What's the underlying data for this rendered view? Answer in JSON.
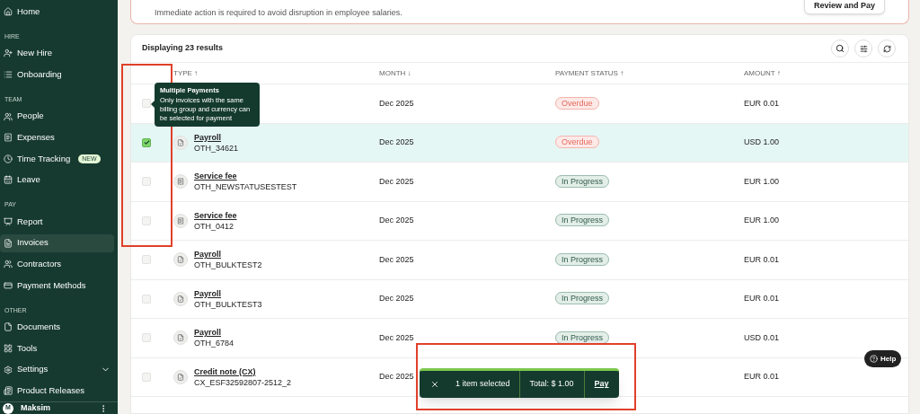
{
  "sidebar": {
    "sections": [
      {
        "items": [
          {
            "label": "Home",
            "selected": false
          }
        ]
      },
      {
        "heading": "HIRE",
        "items": [
          {
            "label": "New Hire",
            "selected": false
          },
          {
            "label": "Onboarding",
            "selected": false
          }
        ]
      },
      {
        "heading": "TEAM",
        "items": [
          {
            "label": "People",
            "selected": false
          },
          {
            "label": "Expenses",
            "selected": false
          },
          {
            "label": "Time Tracking",
            "badge": "NEW",
            "selected": false
          },
          {
            "label": "Leave",
            "selected": false
          }
        ]
      },
      {
        "heading": "PAY",
        "items": [
          {
            "label": "Report",
            "selected": false
          },
          {
            "label": "Invoices",
            "selected": true
          },
          {
            "label": "Contractors",
            "selected": false
          },
          {
            "label": "Payment Methods",
            "selected": false
          }
        ]
      },
      {
        "heading": "OTHER",
        "items": [
          {
            "label": "Documents",
            "selected": false
          },
          {
            "label": "Tools",
            "selected": false
          },
          {
            "label": "Settings",
            "selected": false,
            "expanded": false
          },
          {
            "label": "Product Releases",
            "selected": false
          }
        ]
      }
    ],
    "user": {
      "initial": "M",
      "name": "Maksim"
    }
  },
  "alert": {
    "message": "Immediate action is required to avoid disruption in employee salaries.",
    "button": "Review and Pay"
  },
  "table": {
    "count": "Displaying 23 results",
    "columns": [
      {
        "label": "TYPE ↑"
      },
      {
        "label": "MONTH ↓"
      },
      {
        "label": "PAYMENT STATUS ↑"
      },
      {
        "label": "AMOUNT ↑"
      }
    ],
    "rows": [
      {
        "selected": false,
        "month": "Dec 2025",
        "status": {
          "label": "Overdue",
          "kind": "overdue"
        },
        "amount": "EUR 0.01"
      },
      {
        "selected": true,
        "type": "Payroll",
        "ref": "OTH_34621",
        "kind": "document",
        "month": "Dec 2025",
        "status": {
          "label": "Overdue",
          "kind": "overdue"
        },
        "amount": "USD 1.00"
      },
      {
        "selected": false,
        "type": "Service fee",
        "ref": "OTH_NEWSTATUSESTEST",
        "kind": "fee",
        "month": "Dec 2025",
        "status": {
          "label": "In Progress",
          "kind": "progress"
        },
        "amount": "EUR 1.00"
      },
      {
        "selected": false,
        "type": "Service fee",
        "ref": "OTH_0412",
        "kind": "fee",
        "month": "Dec 2025",
        "status": {
          "label": "In Progress",
          "kind": "progress"
        },
        "amount": "EUR 1.00"
      },
      {
        "selected": false,
        "type": "Payroll",
        "ref": "OTH_BULKTEST2",
        "kind": "document",
        "month": "Dec 2025",
        "status": {
          "label": "In Progress",
          "kind": "progress"
        },
        "amount": "EUR 0.01"
      },
      {
        "selected": false,
        "type": "Payroll",
        "ref": "OTH_BULKTEST3",
        "kind": "document",
        "month": "Dec 2025",
        "status": {
          "label": "In Progress",
          "kind": "progress"
        },
        "amount": "EUR 0.01"
      },
      {
        "selected": false,
        "type": "Payroll",
        "ref": "OTH_6784",
        "kind": "document",
        "month": "Dec 2025",
        "status": {
          "label": "In Progress",
          "kind": "progress"
        },
        "amount": "USD 0.01"
      },
      {
        "selected": false,
        "type": "Credit note (CX)",
        "ref": "CX_ESF32592807-2512_2",
        "kind": "document",
        "month": "Dec 2025",
        "amount": "EUR 0.01"
      }
    ]
  },
  "tooltip": {
    "title": "Multiple Payments",
    "body": "Only invoices with the same billing group and currency can be selected for payment"
  },
  "selection_bar": {
    "count": "1 item selected",
    "total": "Total: $ 1.00",
    "action": "Pay"
  },
  "help": {
    "label": "Help"
  }
}
